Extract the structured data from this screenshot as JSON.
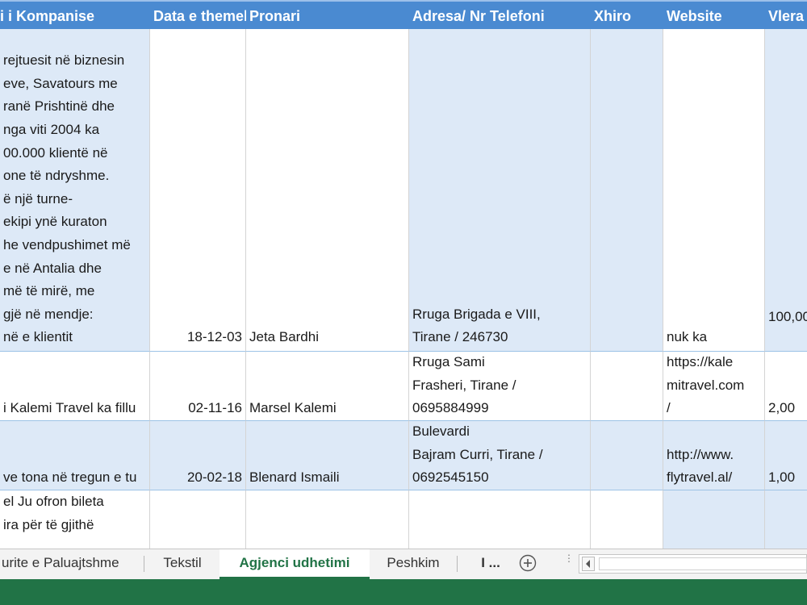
{
  "columns": {
    "company": "i i Kompanise",
    "date": "Data e themelimit",
    "owner": "Pronari",
    "address": "Adresa/ Nr Telefoni",
    "turnover": "Xhiro",
    "website": "Website",
    "value": "Vlera"
  },
  "rows": [
    {
      "description": "rejtuesit në biznesin\neve, Savatours me\nranë Prishtinë dhe\n nga viti 2004 ka\n00.000 klientë në\none të ndryshme.\në një turne-\nekipi ynë kuraton\nhe vendpushimet më\ne në Antalia dhe\n më të mirë, me\n gjë në mendje:\nnë e klientit",
      "date": "18-12-03",
      "owner": "Jeta Bardhi",
      "address": "Rruga Brigada e VIII,\nTirane / 246730",
      "turnover": "",
      "website": "nuk ka",
      "value": "100,00"
    },
    {
      "description": "i Kalemi Travel ka fillu",
      "date": "02-11-16",
      "owner": "Marsel Kalemi",
      "address": "Rruga Sami\nFrasheri, Tirane /\n0695884999",
      "turnover": "",
      "website": "https://kale\nmitravel.com\n/",
      "value": "2,00"
    },
    {
      "description": "ve tona në tregun e tu",
      "date": "20-02-18",
      "owner": "Blenard Ismaili",
      "address": "Bulevardi\nBajram Curri, Tirane /\n0692545150",
      "turnover": "",
      "website": "http://www.\nflytravel.al/",
      "value": "1,00"
    },
    {
      "description": "el Ju ofron bileta\nira për të gjithë",
      "date": "",
      "owner": "",
      "address": "",
      "turnover": "",
      "website": "",
      "value": ""
    }
  ],
  "sheet_tabs": {
    "tab1": "urite e Paluajtshme",
    "tab2": "Tekstil",
    "tab3": "Agjenci udhetimi",
    "tab4": "Peshkim",
    "more": "I ..."
  },
  "colors": {
    "header_bg": "#4a8ad1",
    "band_bg": "#dde9f7",
    "accent_green": "#217346"
  }
}
